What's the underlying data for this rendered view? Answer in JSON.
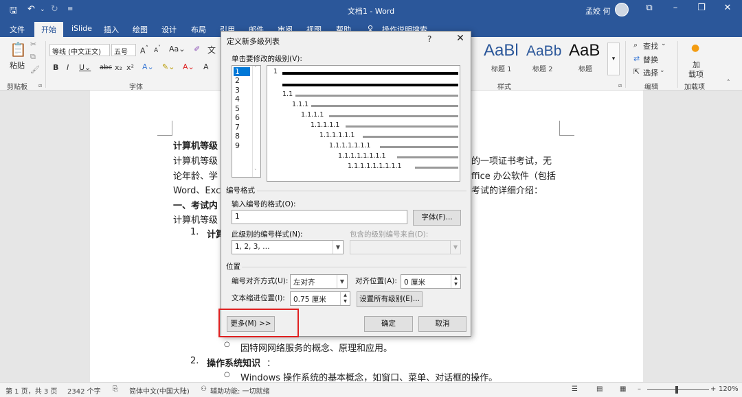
{
  "window": {
    "doc_title": "文档1 - Word",
    "user": "孟姣 何"
  },
  "quick_access": {
    "save_icon": "save-icon",
    "undo_icon": "undo-icon",
    "redo_icon": "redo-icon",
    "customize_icon": "customize-icon"
  },
  "tabs": [
    {
      "label": "文件"
    },
    {
      "label": "开始"
    },
    {
      "label": "iSlide"
    },
    {
      "label": "插入"
    },
    {
      "label": "绘图"
    },
    {
      "label": "设计"
    },
    {
      "label": "布局"
    },
    {
      "label": "引用"
    },
    {
      "label": "邮件"
    },
    {
      "label": "审阅"
    },
    {
      "label": "视图"
    },
    {
      "label": "帮助"
    },
    {
      "label": "操作说明搜索"
    }
  ],
  "ribbon": {
    "paste_label": "粘贴",
    "clipboard_label": "剪贴板",
    "font_name": "等线 (中文正文)",
    "font_size": "五号",
    "font_group_label": "字体",
    "style_group_label": "样式",
    "edit_group_label": "编辑",
    "addins_group_label": "加载项",
    "styles": [
      {
        "sample": "AaBl",
        "name": ""
      },
      {
        "sample": "AaBb",
        "name": "标题 1"
      },
      {
        "sample": "AaB",
        "name": "标题 2"
      },
      {
        "sample": "",
        "name": "标题"
      }
    ],
    "find_label": "查找",
    "replace_label": "替换",
    "select_label": "选择",
    "addins_label_1": "加",
    "addins_label_2": "载项"
  },
  "document": {
    "lines": [
      "计算机等级",
      "计算机等级",
      "论年龄、学",
      "Word、Exc",
      "一、考试内",
      "计算机等级"
    ],
    "right_fragments": [
      "的一项证书考试，无",
      "ffice 办公软件（包括",
      "考试的详细介绍："
    ],
    "list_1_num": "1.",
    "list_1_text": "计算",
    "bullet_text": "因特网网络服务的概念、原理和应用。",
    "list_2_num": "2.",
    "list_2_text": "操作系统知识",
    "list_2_suffix": "：",
    "bullet_2_text": "Windows 操作系统的基本概念，如窗口、菜单、对话框的操作。"
  },
  "statusbar": {
    "page": "第 1 页，共 3 页",
    "words": "2342 个字",
    "language": "简体中文(中国大陆)",
    "accessibility": "辅助功能: 一切就绪",
    "zoom": "120%"
  },
  "dialog": {
    "title": "定义新多级列表",
    "help": "?",
    "close": "✕",
    "click_level_label": "单击要修改的级别(V):",
    "levels": [
      "1",
      "2",
      "3",
      "4",
      "5",
      "6",
      "7",
      "8",
      "9"
    ],
    "preview_numbers": [
      "1",
      "1.1",
      "1.1.1",
      "1.1.1.1",
      "1.1.1.1.1",
      "1.1.1.1.1.1",
      "1.1.1.1.1.1.1",
      "1.1.1.1.1.1.1.1",
      "1.1.1.1.1.1.1.1.1"
    ],
    "number_format_section": "编号格式",
    "enter_format_label": "输入编号的格式(O):",
    "format_value": "1",
    "font_button": "字体(F)...",
    "number_style_label": "此级别的编号样式(N):",
    "number_style_value": "1, 2, 3, …",
    "include_level_label": "包含的级别编号来自(D):",
    "position_section": "位置",
    "alignment_label": "编号对齐方式(U):",
    "alignment_value": "左对齐",
    "align_at_label": "对齐位置(A):",
    "align_at_value": "0 厘米",
    "indent_label": "文本缩进位置(I):",
    "indent_value": "0.75 厘米",
    "set_all_button": "设置所有级别(E)...",
    "more_button": "更多(M) >>",
    "ok_button": "确定",
    "cancel_button": "取消"
  },
  "colors": {
    "brand": "#2b579a",
    "highlight": "#e02020",
    "selection": "#0078d7"
  }
}
